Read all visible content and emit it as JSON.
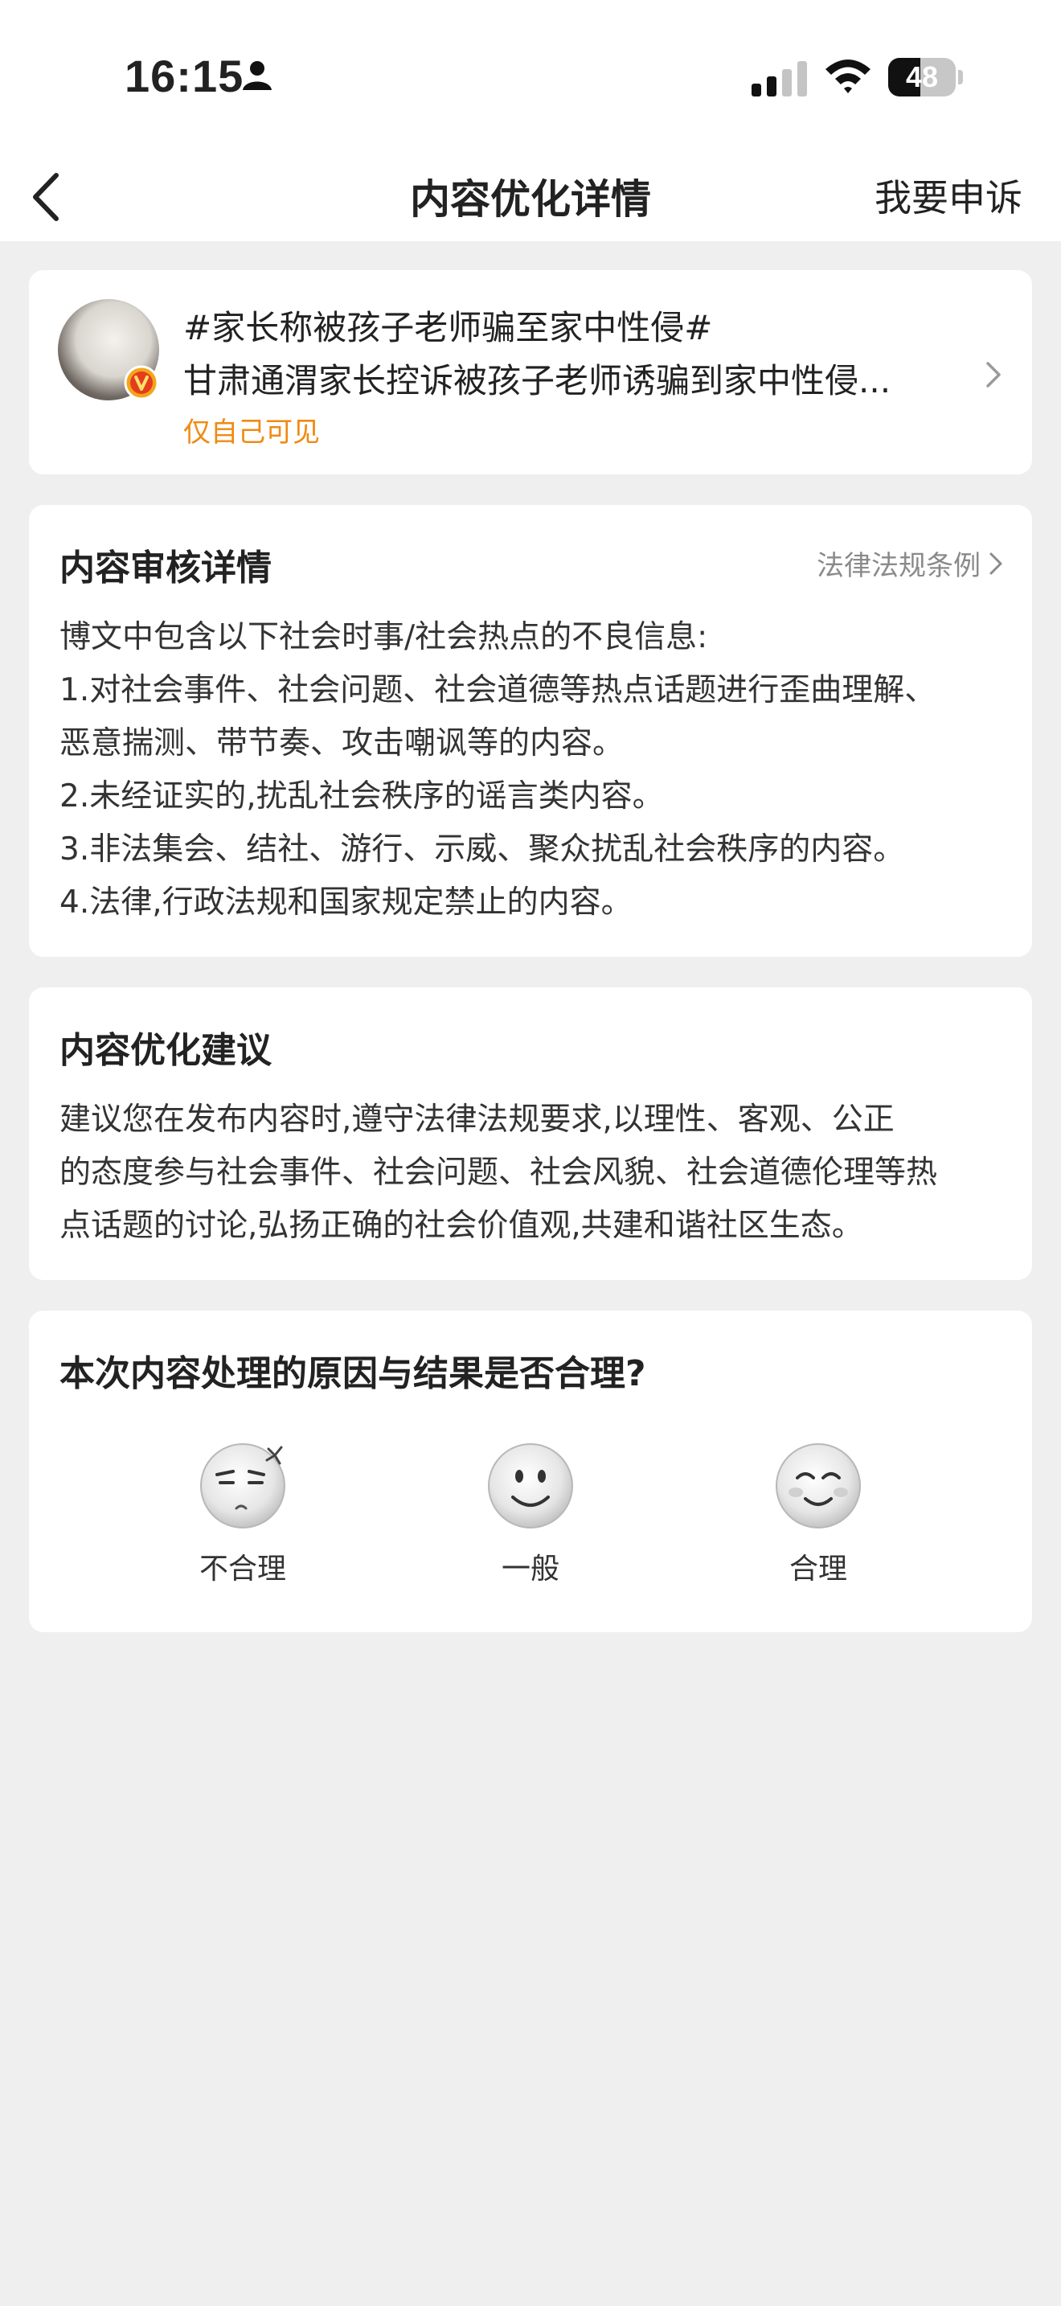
{
  "status_bar": {
    "time": "16:15",
    "battery_level": 48,
    "battery_text": "48"
  },
  "nav": {
    "title": "内容优化详情",
    "appeal_label": "我要申诉"
  },
  "post": {
    "hashtag": "#家长称被孩子老师骗至家中性侵#",
    "text": "甘肃通渭家长控诉被孩子老师诱骗到家中性侵...",
    "visibility": "仅自己可见"
  },
  "review": {
    "title": "内容审核详情",
    "law_link": "法律法规条例",
    "lines": [
      "博文中包含以下社会时事/社会热点的不良信息:",
      "1.对社会事件、社会问题、社会道德等热点话题进行歪曲理解、",
      "恶意揣测、带节奏、攻击嘲讽等的内容。",
      "2.未经证实的,扰乱社会秩序的谣言类内容。",
      "3.非法集会、结社、游行、示威、聚众扰乱社会秩序的内容。",
      "4.法律,行政法规和国家规定禁止的内容。"
    ]
  },
  "suggestion": {
    "title": "内容优化建议",
    "lines": [
      "建议您在发布内容时,遵守法律法规要求,以理性、客观、公正",
      "的态度参与社会事件、社会问题、社会风貌、社会道德伦理等热",
      "点话题的讨论,弘扬正确的社会价值观,共建和谐社区生态。"
    ]
  },
  "rating": {
    "question": "本次内容处理的原因与结果是否合理?",
    "options": [
      {
        "label": "不合理",
        "icon": "annoyed-face-icon"
      },
      {
        "label": "一般",
        "icon": "neutral-smile-face-icon"
      },
      {
        "label": "合理",
        "icon": "happy-face-icon"
      }
    ]
  },
  "colors": {
    "accent": "#ef8a12",
    "background": "#efefef",
    "card": "#ffffff"
  }
}
